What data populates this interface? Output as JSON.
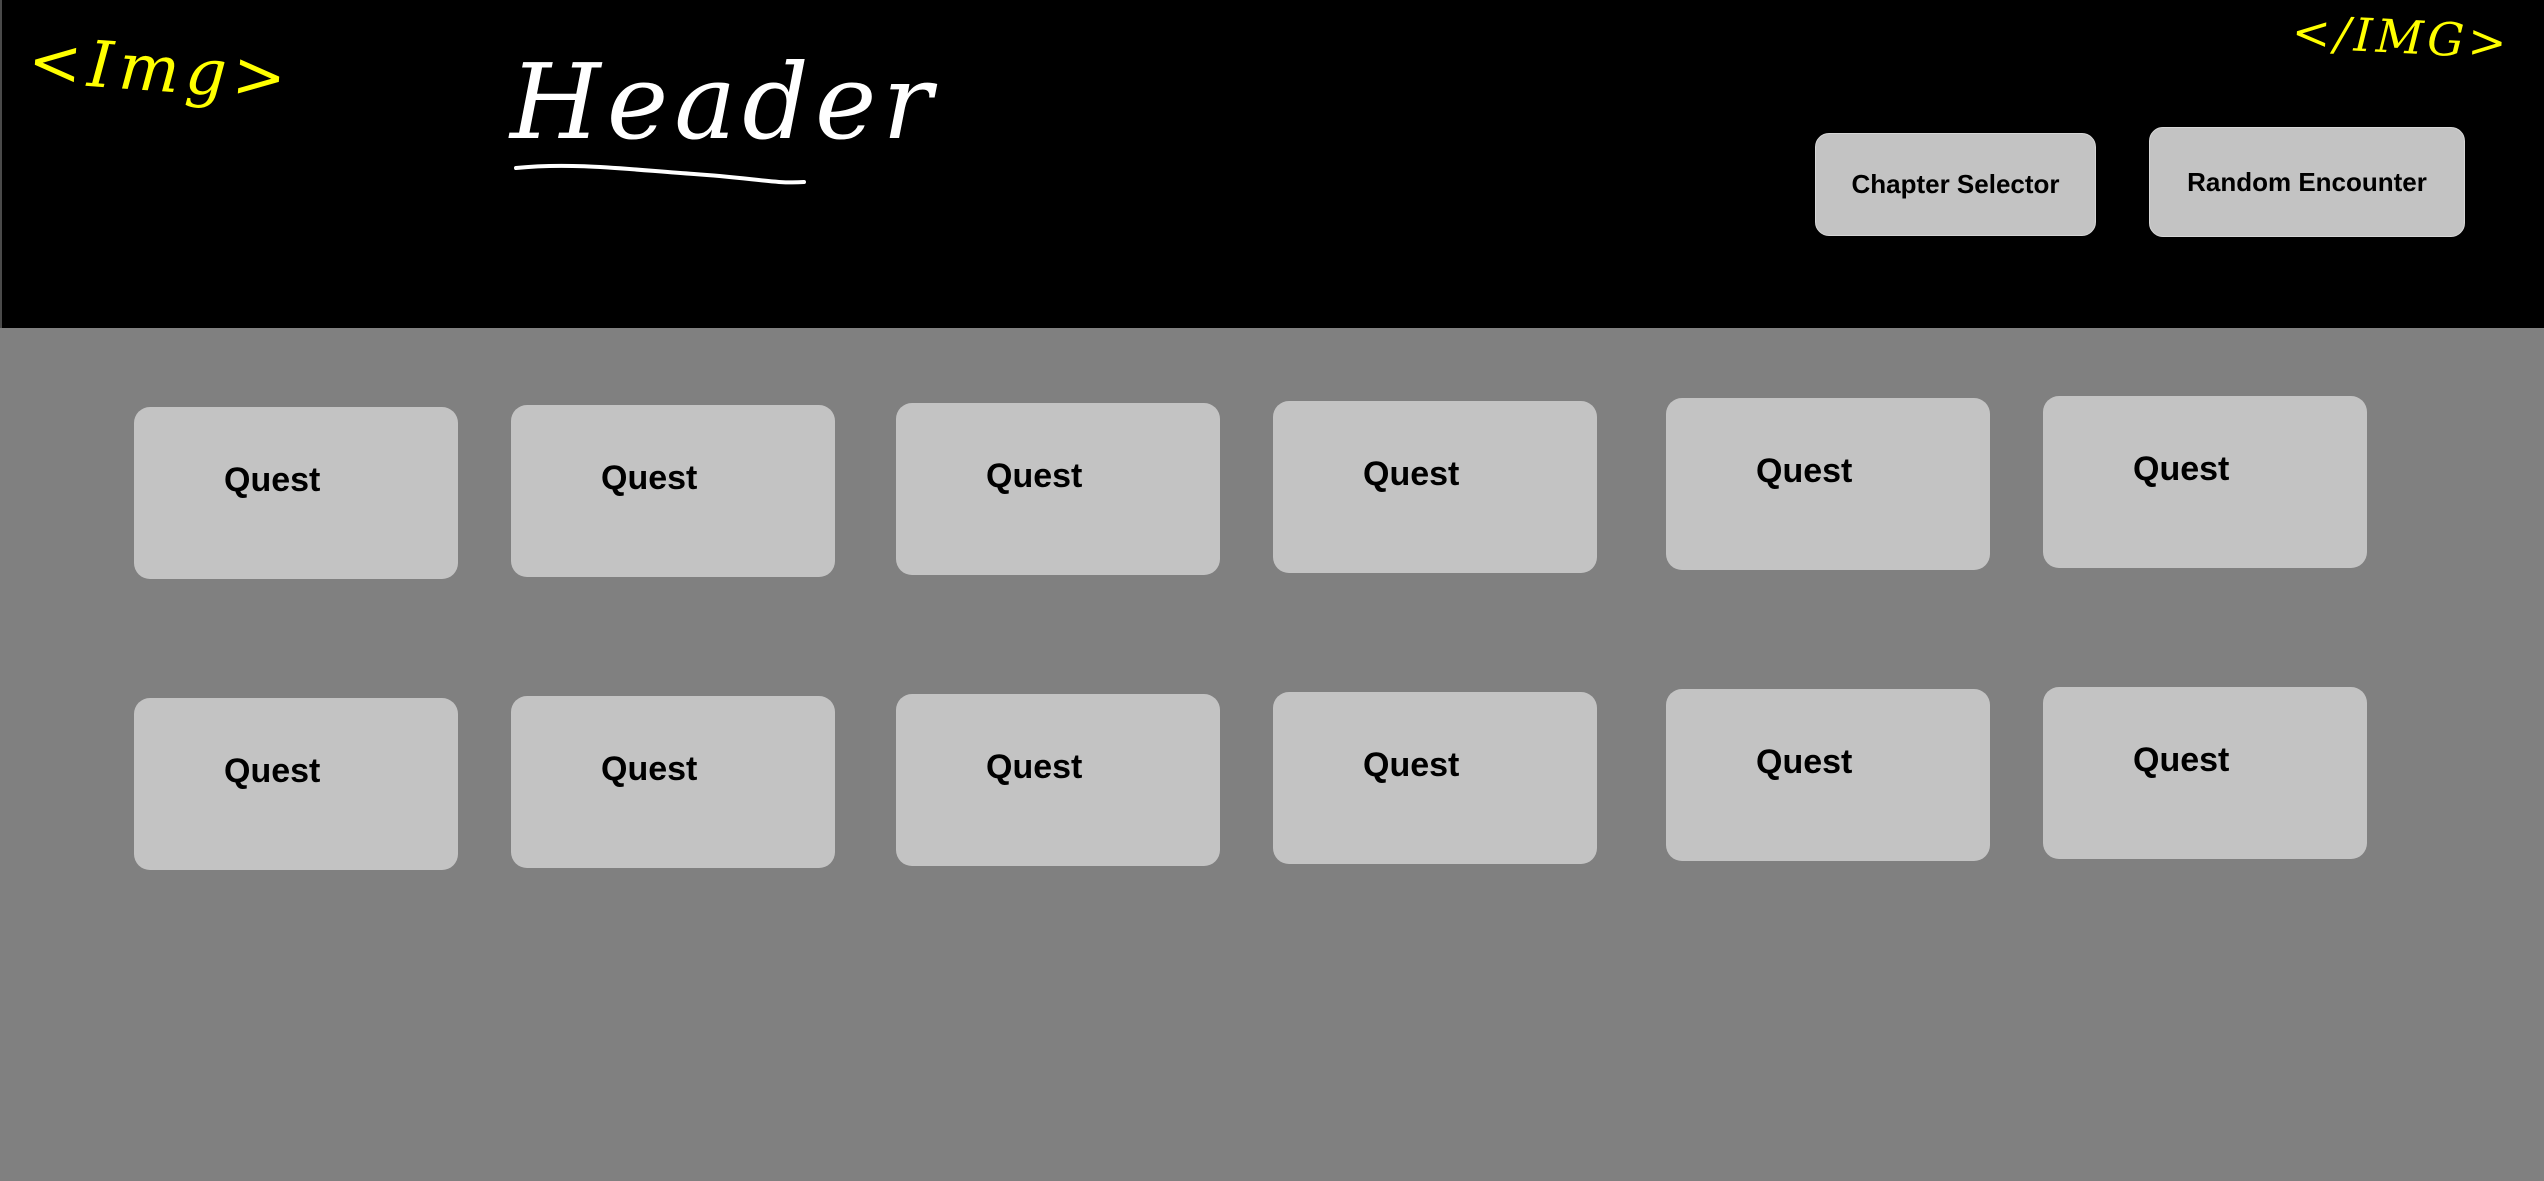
{
  "header": {
    "logo_left_text": "<Img>",
    "logo_right_text": "</IMG>",
    "title": "Header",
    "background_color": "#000000",
    "title_color": "#ffffff",
    "sketch_color": "#ffff00"
  },
  "nav": {
    "chapter_selector_label": "Chapter Selector",
    "random_encounter_label": "Random Encounter"
  },
  "quests": {
    "row1": [
      {
        "label": "Quest"
      },
      {
        "label": "Quest"
      },
      {
        "label": "Quest"
      },
      {
        "label": "Quest"
      },
      {
        "label": "Quest"
      },
      {
        "label": "Quest"
      }
    ],
    "row2": [
      {
        "label": "Quest"
      },
      {
        "label": "Quest"
      },
      {
        "label": "Quest"
      },
      {
        "label": "Quest"
      },
      {
        "label": "Quest"
      },
      {
        "label": "Quest"
      }
    ]
  },
  "colors": {
    "page_background": "#808080",
    "card_background": "#c3c3c3"
  }
}
